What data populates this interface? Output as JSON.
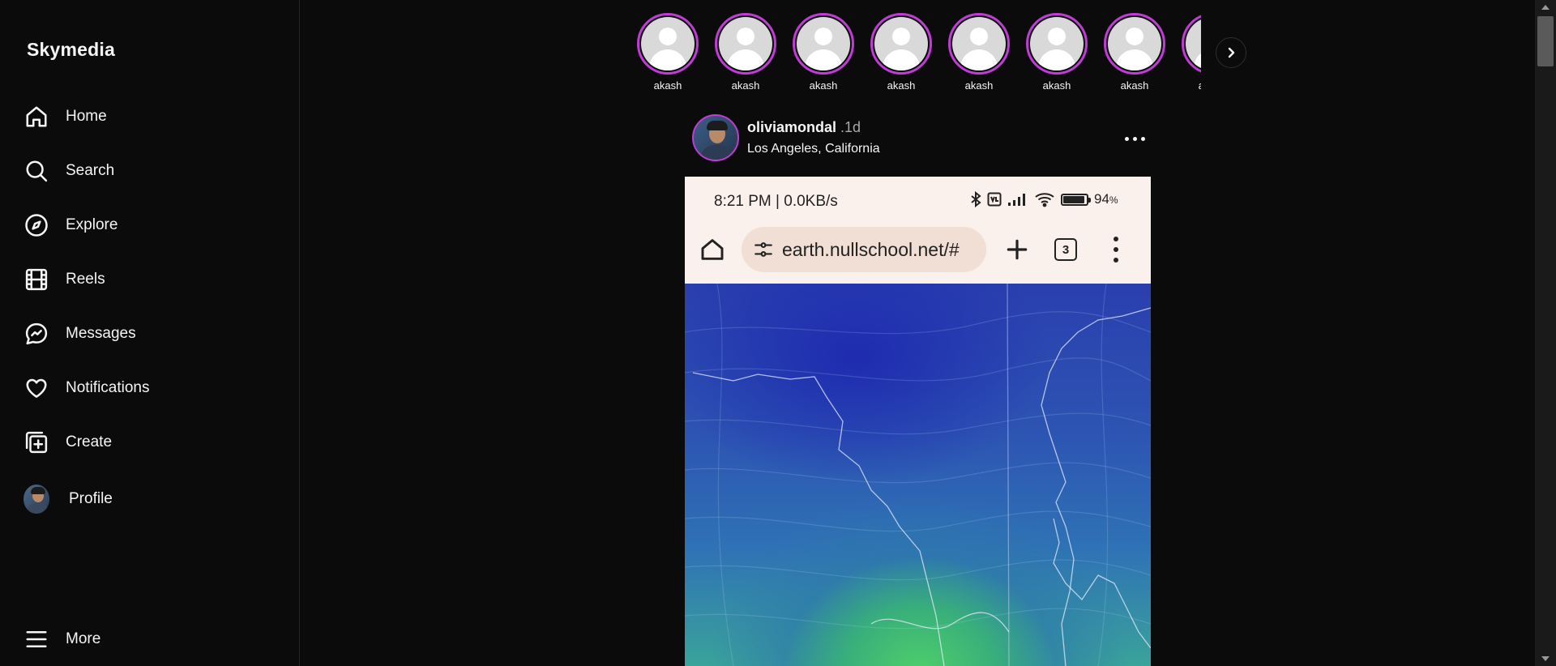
{
  "app": {
    "brand": "Skymedia"
  },
  "sidebar": {
    "items": [
      {
        "label": "Home",
        "icon": "home-icon"
      },
      {
        "label": "Search",
        "icon": "search-icon"
      },
      {
        "label": "Explore",
        "icon": "compass-icon"
      },
      {
        "label": "Reels",
        "icon": "film-icon"
      },
      {
        "label": "Messages",
        "icon": "messenger-icon"
      },
      {
        "label": "Notifications",
        "icon": "heart-icon"
      },
      {
        "label": "Create",
        "icon": "plus-square-icon"
      },
      {
        "label": "Profile",
        "icon": "avatar"
      }
    ],
    "more_label": "More"
  },
  "stories": {
    "items": [
      {
        "name": "akash"
      },
      {
        "name": "akash"
      },
      {
        "name": "akash"
      },
      {
        "name": "akash"
      },
      {
        "name": "akash"
      },
      {
        "name": "akash"
      },
      {
        "name": "akash"
      },
      {
        "name": "akash"
      }
    ]
  },
  "post": {
    "username": "oliviamondal",
    "time": ".1d",
    "location": "Los Angeles, California",
    "screenshot": {
      "status_time": "8:21 PM | 0.0KB/s",
      "battery": "94",
      "battery_unit": "%",
      "battery_level": 0.94,
      "url": "earth.nullschool.net/#",
      "tab_count": "3"
    }
  },
  "colors": {
    "background": "#0b0b0b",
    "story_ring": "#c13bd6",
    "text": "#f5f5f5",
    "secondary_text": "#a8a8a8"
  }
}
